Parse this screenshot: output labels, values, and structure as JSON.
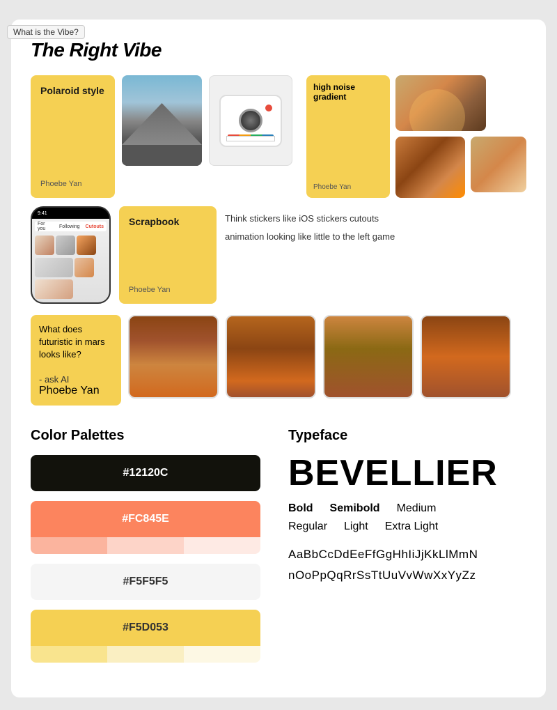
{
  "tooltip": "What is the Vibe?",
  "main": {
    "section_title": "The Right Vibe",
    "cards": [
      {
        "title": "Polaroid style",
        "author": "Phoebe Yan"
      },
      {
        "title": "Scrapbook",
        "author": "Phoebe Yan"
      },
      {
        "title": "high noise gradient",
        "author": "Phoebe Yan"
      },
      {
        "title": "What does futuristic in mars looks like?\n\n- ask AI",
        "author": "Phoebe Yan"
      }
    ],
    "text_notes": [
      "Think stickers like iOS stickers cutouts",
      "animation looking like little to the left game"
    ]
  },
  "color_palettes": {
    "title": "Color Palettes",
    "swatches": [
      {
        "hex": "#12120C",
        "label": "#12120C",
        "type": "dark"
      },
      {
        "hex": "#FC845E",
        "label": "#FC845E",
        "type": "coral"
      },
      {
        "hex": "#F5F5F5",
        "label": "#F5F5F5",
        "type": "light"
      },
      {
        "hex": "#F5D053",
        "label": "#F5D053",
        "type": "yellow"
      }
    ]
  },
  "typeface": {
    "title": "Typeface",
    "hero_name": "BEVELLIER",
    "weights_row1": [
      "Bold",
      "Semibold",
      "Medium"
    ],
    "weights_row2": [
      "Regular",
      "Light",
      "Extra Light"
    ],
    "alphabet_upper": "AaBbCcDdEeFfGgHhIiJjKkLlMmN",
    "alphabet_lower": "nOoPpQqRrSsTtUuVvWwXxYyZz"
  }
}
